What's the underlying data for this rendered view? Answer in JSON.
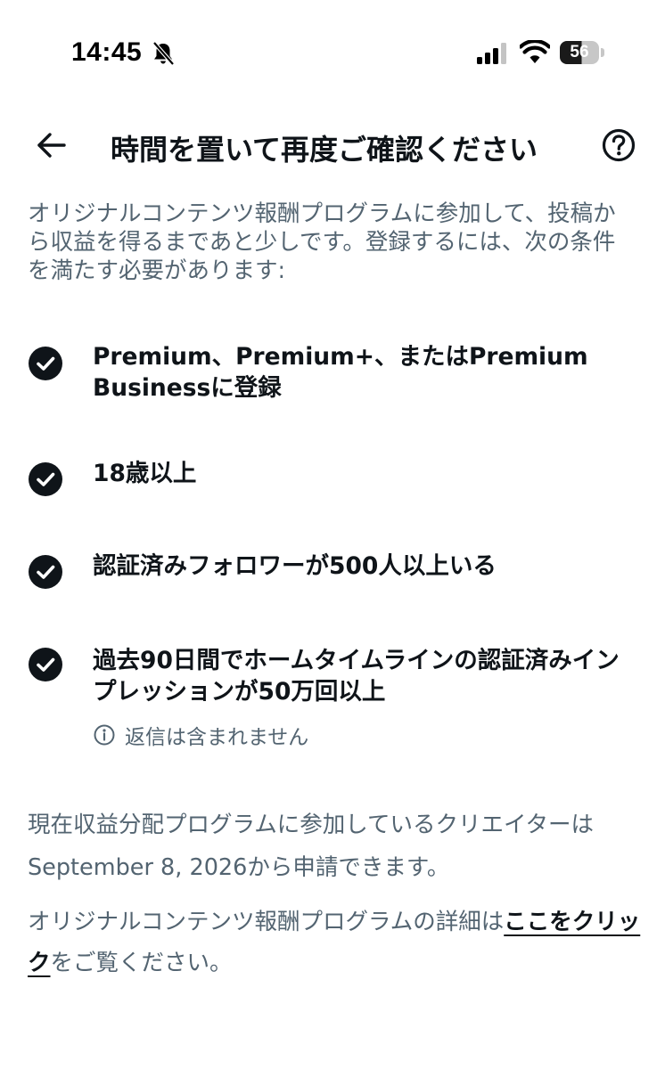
{
  "status_bar": {
    "time": "14:45",
    "bell_icon": "bell-slash-icon",
    "signal_icon": "cellular-signal-icon",
    "wifi_icon": "wifi-icon",
    "battery_level": "56"
  },
  "header": {
    "back_icon": "arrow-left-icon",
    "title": "時間を置いて再度ご確認ください",
    "help_icon": "question-circle-icon"
  },
  "intro": "オリジナルコンテンツ報酬プログラムに参加して、投稿から収益を得るまであと少しです。登録するには、次の条件を満たす必要があります:",
  "requirements": [
    {
      "text": "Premium、Premium+、またはPremium Businessに登録",
      "met": true
    },
    {
      "text": "18歳以上",
      "met": true
    },
    {
      "text": "認証済みフォロワーが500人以上いる",
      "met": true
    },
    {
      "text": "過去90日間でホームタイムラインの認証済みインプレッションが50万回以上",
      "met": true,
      "note": "返信は含まれません"
    }
  ],
  "availability": "現在収益分配プログラムに参加しているクリエイターはSeptember 8, 2026から申請できます。",
  "details": {
    "prefix": "オリジナルコンテンツ報酬プログラムの詳細は",
    "link": "ここをクリック",
    "suffix": "をご覧ください。"
  },
  "colors": {
    "primary_text": "#0f1419",
    "secondary_text": "#536471",
    "background": "#ffffff"
  }
}
